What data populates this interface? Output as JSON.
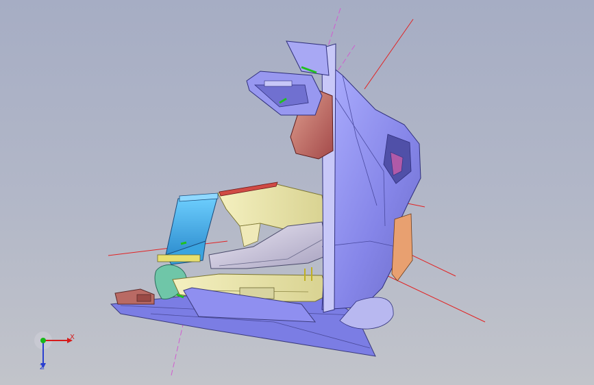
{
  "viewport": {
    "background_top": "#a6adc4",
    "background_bottom": "#c2c4ca"
  },
  "triad": {
    "x_label": "X",
    "z_label": "Z",
    "x_color": "#d61b1b",
    "y_color": "#18b818",
    "z_color": "#2a3fd0"
  },
  "model": {
    "icon": "cad-assembly-3d-model",
    "colors": {
      "body": "#8f8ff0",
      "seat": "#c0616a",
      "floor": "#e8e3a0",
      "frame": "#4fb3e6",
      "pedal": "#b06060",
      "construction_line": "#e22222",
      "axis_line": "#d05cd0"
    }
  }
}
